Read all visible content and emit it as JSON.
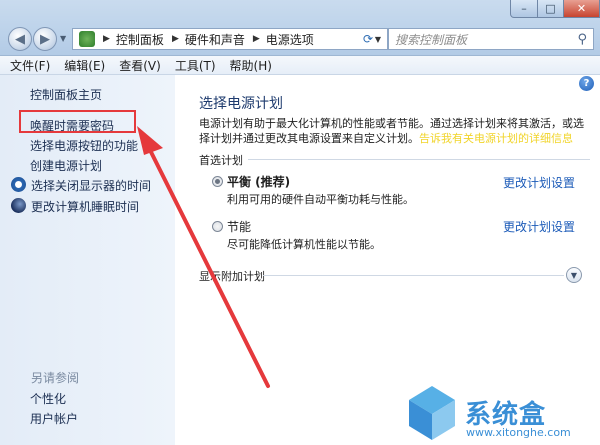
{
  "window": {
    "min_glyph": "–",
    "max_glyph": "□",
    "close_glyph": "✕"
  },
  "address": {
    "crumbs": [
      "控制面板",
      "硬件和声音",
      "电源选项"
    ],
    "search_placeholder": "搜索控制面板"
  },
  "menu": {
    "items": [
      "文件(F)",
      "编辑(E)",
      "查看(V)",
      "工具(T)",
      "帮助(H)"
    ]
  },
  "sidebar": {
    "home": "控制面板主页",
    "links": [
      "唤醒时需要密码",
      "选择电源按钮的功能",
      "创建电源计划",
      "选择关闭显示器的时间",
      "更改计算机睡眠时间"
    ],
    "see_also_title": "另请参阅",
    "see_also": [
      "个性化",
      "用户帐户"
    ]
  },
  "main": {
    "title": "选择电源计划",
    "description": "电源计划有助于最大化计算机的性能或者节能。通过选择计划来将其激活，或选择计划并通过更改其电源设置来自定义计划。",
    "description_link": "告诉我有关电源计划的详细信息",
    "preferred_label": "首选计划",
    "plans": [
      {
        "name": "平衡 (推荐)",
        "desc": "利用可用的硬件自动平衡功耗与性能。",
        "selected": true,
        "change": "更改计划设置"
      },
      {
        "name": "节能",
        "desc": "尽可能降低计算机性能以节能。",
        "selected": false,
        "change": "更改计划设置"
      }
    ],
    "more_plans": "显示附加计划"
  },
  "annotation": {
    "color": "#e5393c",
    "target": "唤醒时需要密码"
  },
  "watermark": {
    "text": "系统盒",
    "url": "www.xitonghe.com"
  },
  "colors": {
    "link_blue": "#1c5bb8",
    "sidebar_bg": "#e3ecf7",
    "title_blue": "#1e3b6e"
  }
}
